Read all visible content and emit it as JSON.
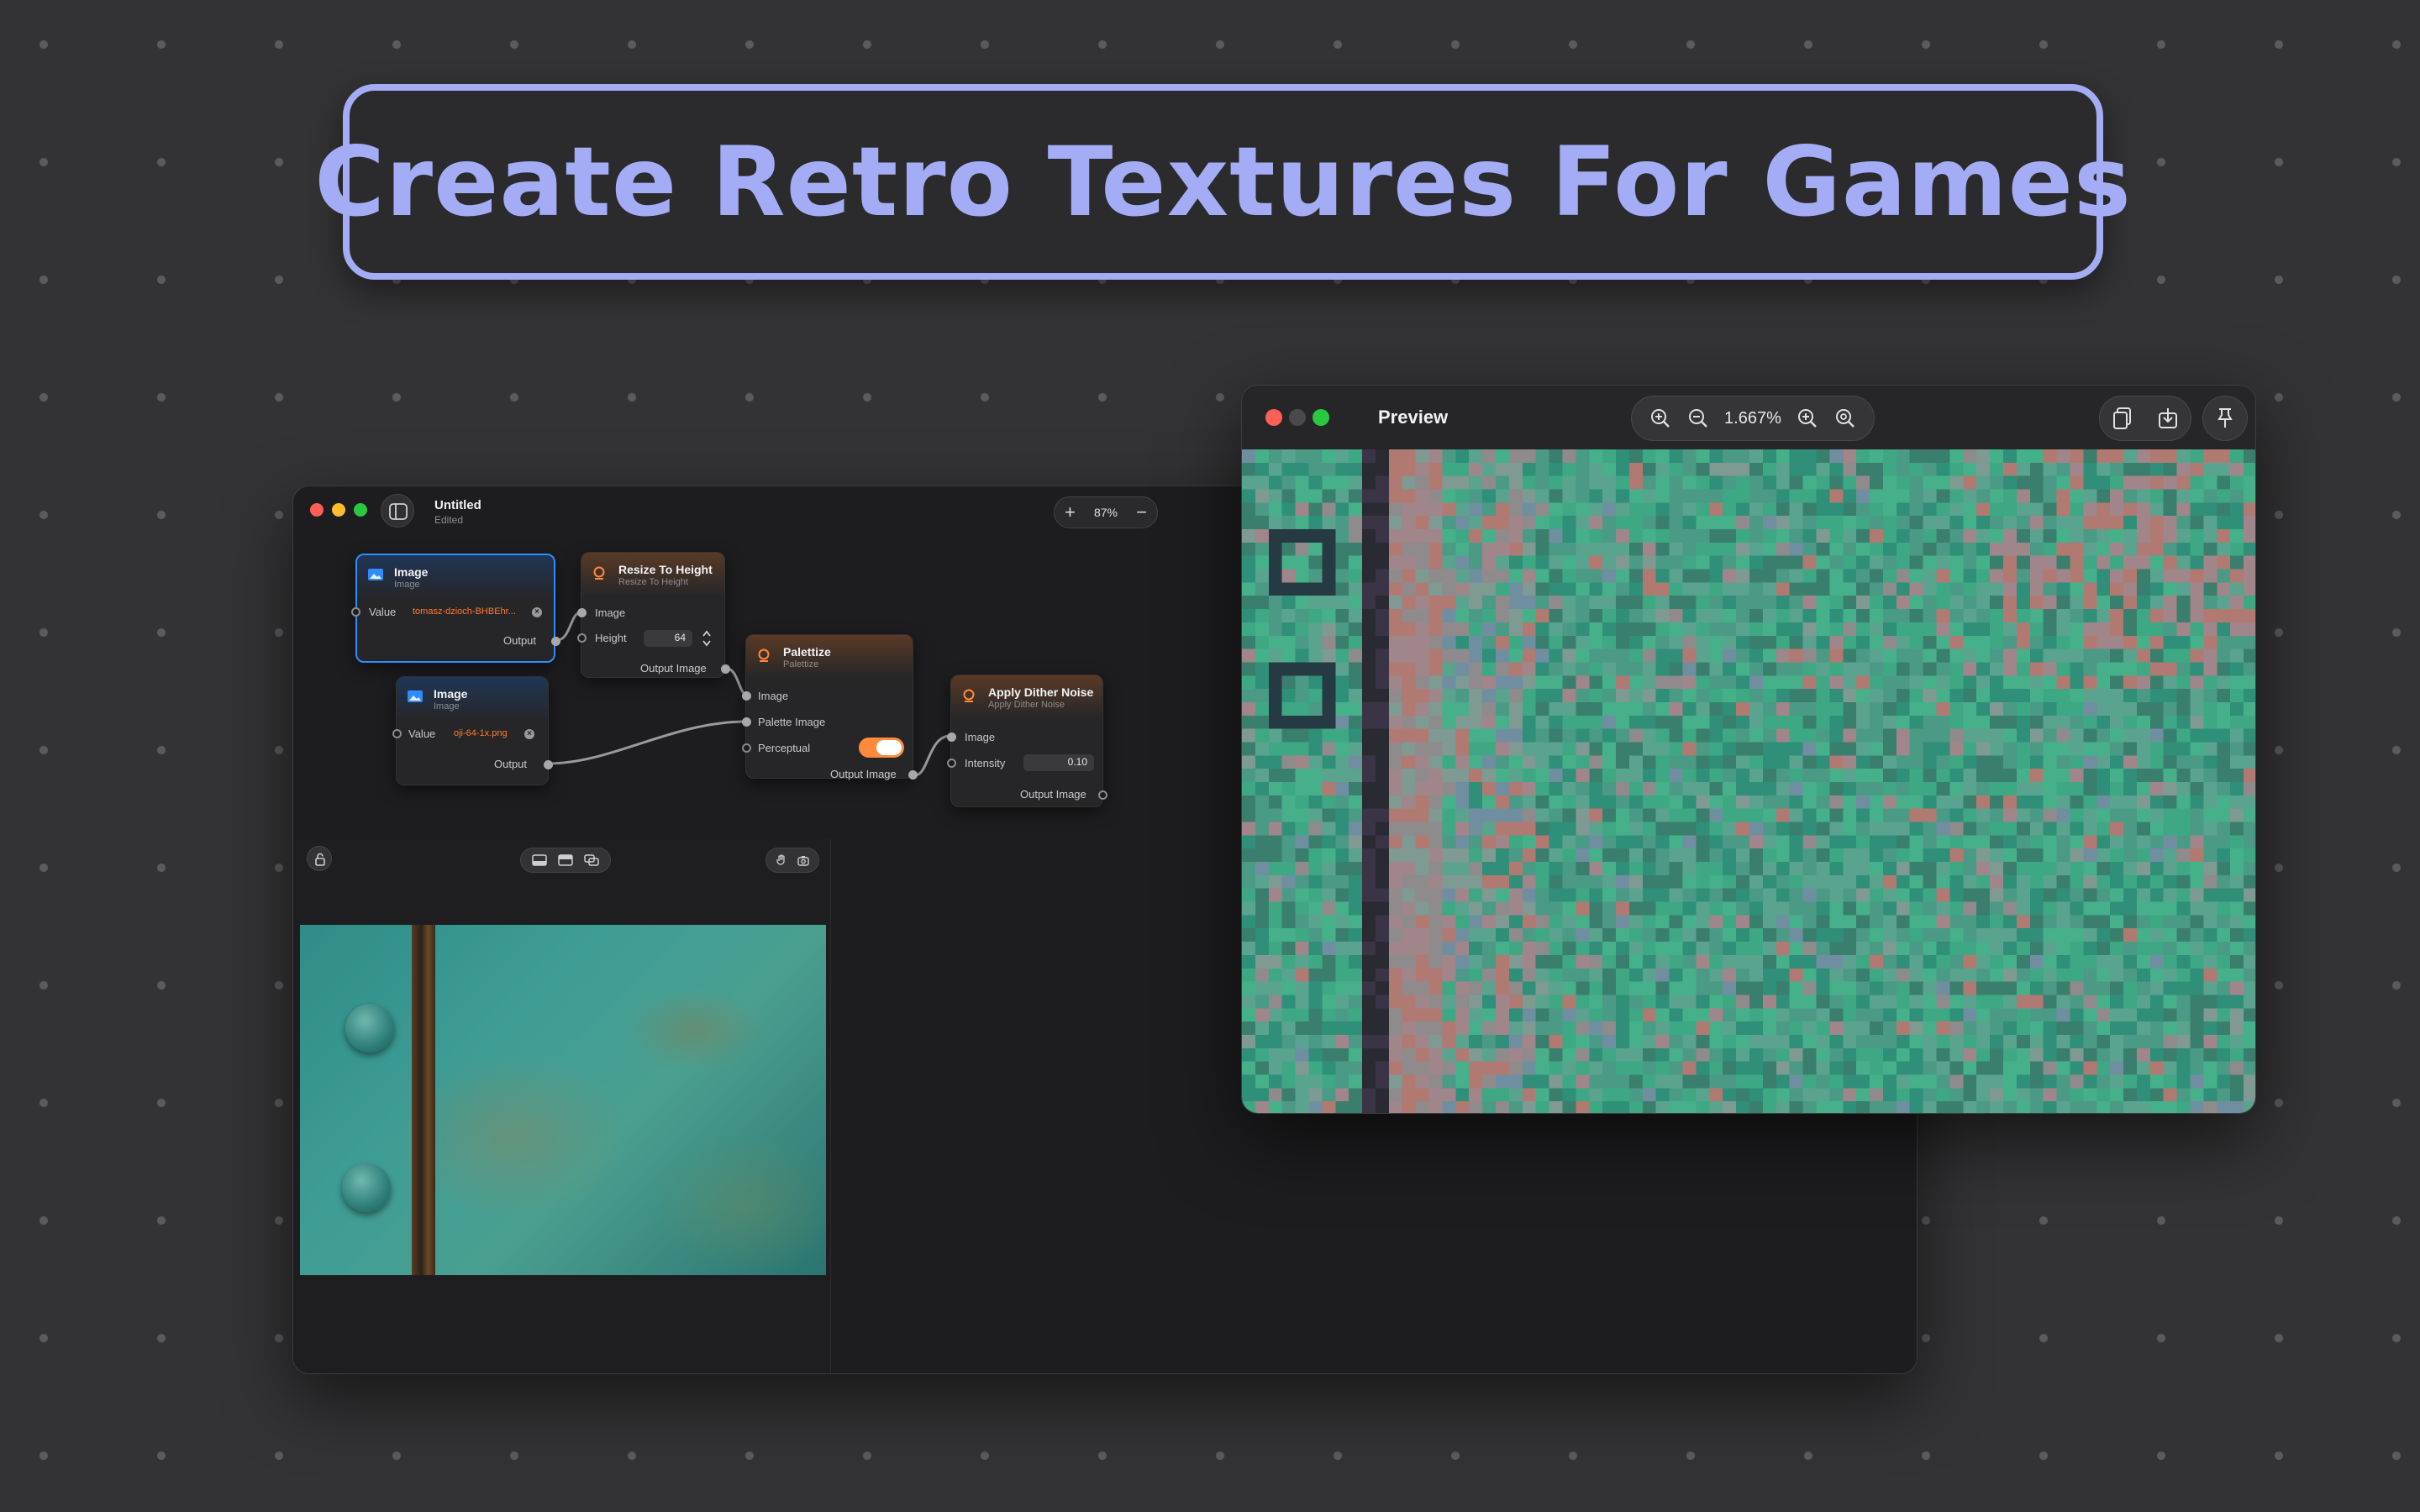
{
  "headline": "Create Retro Textures For Games",
  "editor": {
    "title": "Untitled",
    "subtitle": "Edited",
    "zoom": "87%",
    "zoom_in": "+",
    "zoom_out": "−"
  },
  "nodes": {
    "image1": {
      "title": "Image",
      "subtitle": "Image",
      "value_label": "Value",
      "value": "tomasz-dzioch-BHBEhr...",
      "output_label": "Output"
    },
    "resize": {
      "title": "Resize To Height",
      "subtitle": "Resize To Height",
      "image_label": "Image",
      "height_label": "Height",
      "height_value": "64",
      "output_label": "Output Image"
    },
    "image2": {
      "title": "Image",
      "subtitle": "Image",
      "value_label": "Value",
      "value": "oji-64-1x.png",
      "output_label": "Output"
    },
    "palettize": {
      "title": "Palettize",
      "subtitle": "Palettize",
      "image_label": "Image",
      "palette_label": "Palette Image",
      "perceptual_label": "Perceptual",
      "perceptual_on": true,
      "output_label": "Output Image"
    },
    "dither": {
      "title": "Apply Dither Noise",
      "subtitle": "Apply Dither Noise",
      "image_label": "Image",
      "intensity_label": "Intensity",
      "intensity_value": "0.10",
      "output_label": "Output Image"
    }
  },
  "preview": {
    "title": "Preview",
    "zoom": "1.667%"
  },
  "colors": {
    "accent": "#a3acf5",
    "selection": "#2f8cff",
    "toggle": "#ff8a3a",
    "filename": "#ff7a2f"
  },
  "icons": [
    "sidebar-icon",
    "image-icon",
    "node-icon",
    "zoom-in-icon",
    "zoom-out-icon",
    "copy-icon",
    "download-icon",
    "pin-icon",
    "lock-icon",
    "layout-icons",
    "hand-icon",
    "camera-icon"
  ]
}
